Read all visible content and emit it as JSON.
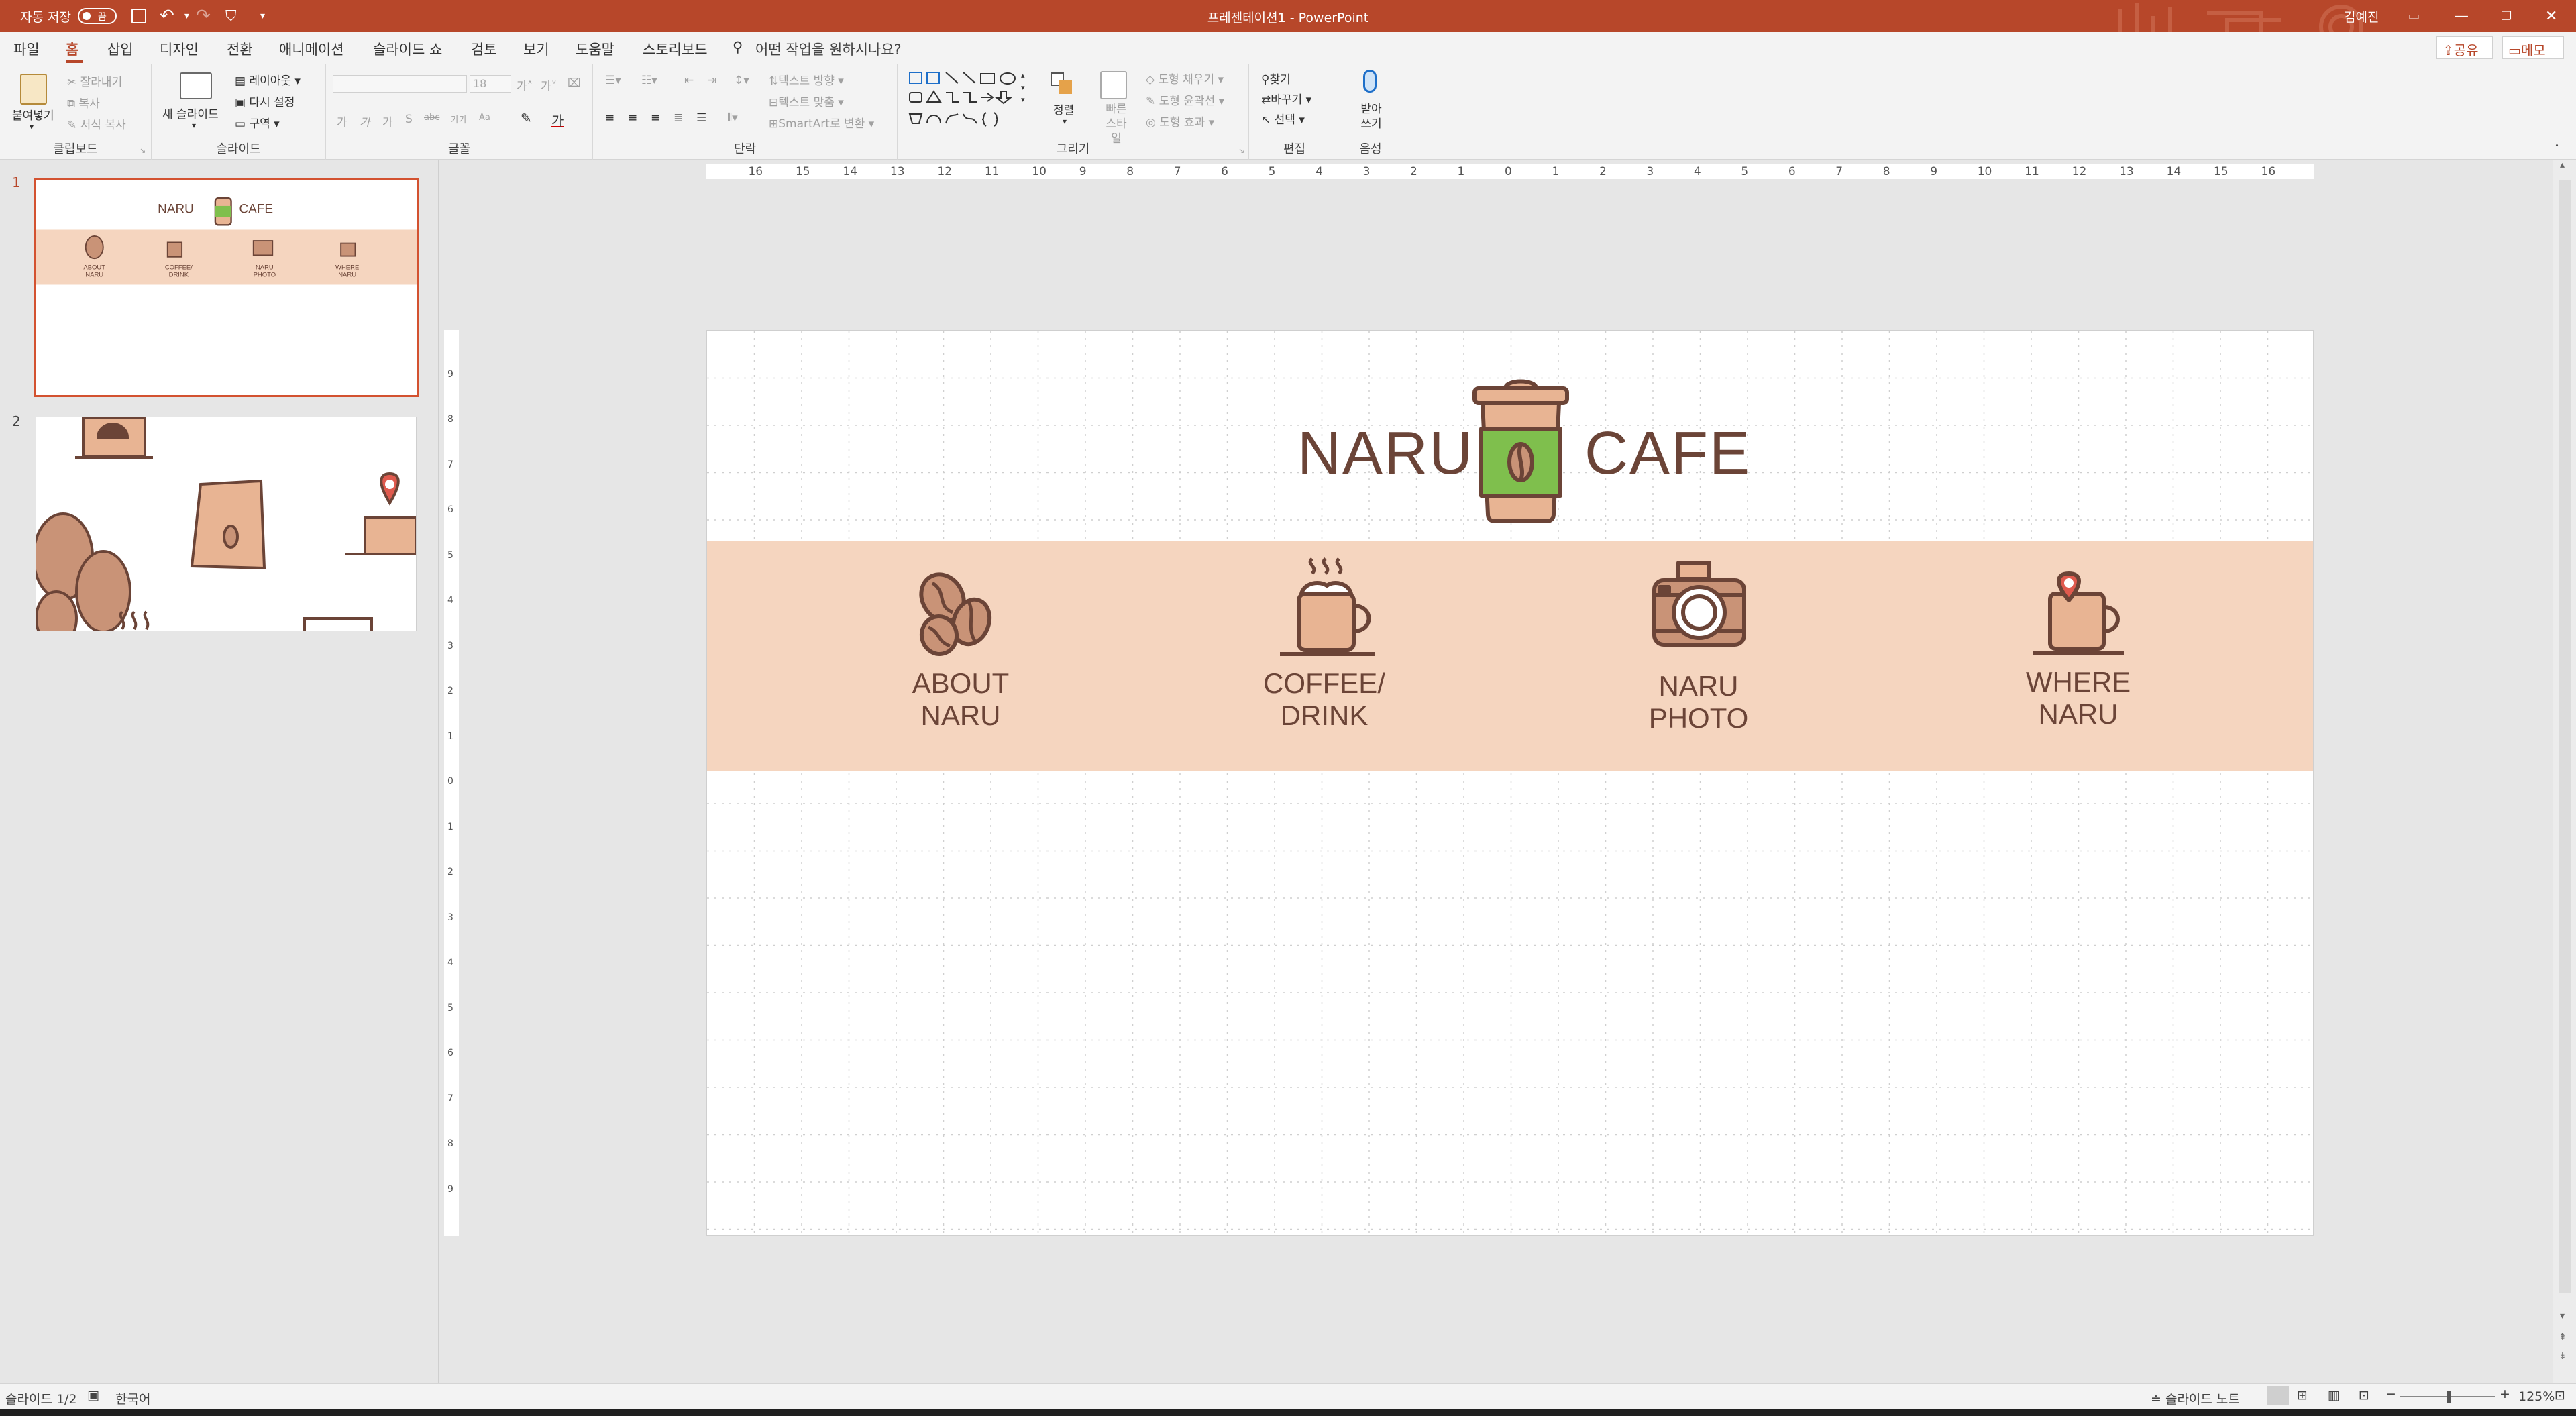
{
  "titlebar": {
    "autosave_label": "자동 저장",
    "autosave_state": "끔",
    "document_title": "프레젠테이션1  -  PowerPoint",
    "user_name": "김예진",
    "accent_color": "#b7472a"
  },
  "menu": {
    "tabs": [
      "파일",
      "홈",
      "삽입",
      "디자인",
      "전환",
      "애니메이션",
      "슬라이드 쇼",
      "검토",
      "보기",
      "도움말",
      "스토리보드"
    ],
    "active_tab": "홈",
    "tell_me": "어떤 작업을 원하시나요?",
    "share": "공유",
    "comments": "메모"
  },
  "ribbon": {
    "clipboard": {
      "label": "클립보드",
      "paste": "붙여넣기",
      "cut": "잘라내기",
      "copy": "복사",
      "format_painter": "서식 복사"
    },
    "slides": {
      "label": "슬라이드",
      "new_slide": "새 슬라이드",
      "layout": "레이아웃",
      "reset": "다시 설정",
      "section": "구역"
    },
    "font": {
      "label": "글꼴",
      "font_name": "",
      "font_size": "18",
      "buttons": [
        "가",
        "가",
        "가",
        "S",
        "abc",
        "가가",
        "Aa"
      ]
    },
    "paragraph": {
      "label": "단락",
      "text_direction": "텍스트 방향",
      "align_text": "텍스트 맞춤",
      "smartart": "SmartArt로 변환"
    },
    "drawing": {
      "label": "그리기",
      "arrange": "정렬",
      "quick_styles": "빠른 스타일",
      "shape_fill": "도형 채우기",
      "shape_outline": "도형 윤곽선",
      "shape_effects": "도형 효과"
    },
    "editing": {
      "label": "편집",
      "find": "찾기",
      "replace": "바꾸기",
      "select": "선택"
    },
    "voice": {
      "label": "음성",
      "dictate": "받아쓰기"
    }
  },
  "ruler": {
    "horizontal": [
      "16",
      "15",
      "14",
      "13",
      "12",
      "11",
      "10",
      "9",
      "8",
      "7",
      "6",
      "5",
      "4",
      "3",
      "2",
      "1",
      "0",
      "1",
      "2",
      "3",
      "4",
      "5",
      "6",
      "7",
      "8",
      "9",
      "10",
      "11",
      "12",
      "13",
      "14",
      "15",
      "16"
    ],
    "vertical": [
      "9",
      "8",
      "7",
      "6",
      "5",
      "4",
      "3",
      "2",
      "1",
      "0",
      "1",
      "2",
      "3",
      "4",
      "5",
      "6",
      "7",
      "8",
      "9"
    ]
  },
  "thumbnails": [
    {
      "number": "1",
      "selected": true
    },
    {
      "number": "2",
      "selected": false
    }
  ],
  "slide": {
    "title_left": "NARU",
    "title_right": "CAFE",
    "band_color": "#f5d5bf",
    "text_color": "#6b4437",
    "items": [
      {
        "line1": "ABOUT",
        "line2": "NARU",
        "icon": "coffee-beans-icon"
      },
      {
        "line1": "COFFEE/",
        "line2": "DRINK",
        "icon": "coffee-cup-icon"
      },
      {
        "line1": "NARU",
        "line2": "PHOTO",
        "icon": "camera-icon"
      },
      {
        "line1": "WHERE",
        "line2": "NARU",
        "icon": "map-pin-cup-icon"
      }
    ]
  },
  "statusbar": {
    "slide_info": "슬라이드 1/2",
    "language": "한국어",
    "notes": "슬라이드 노트",
    "zoom": "125%"
  }
}
